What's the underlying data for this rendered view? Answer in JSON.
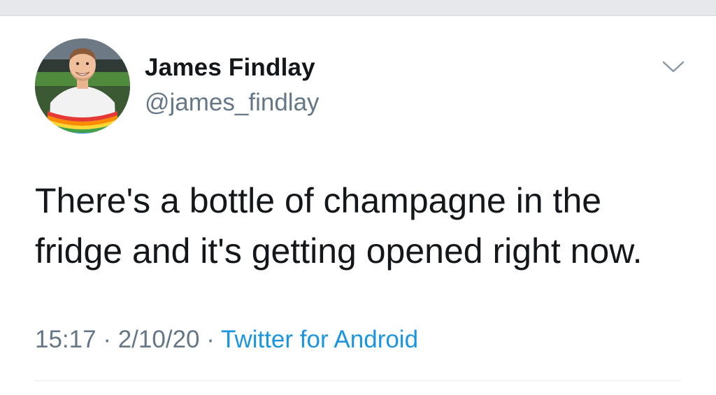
{
  "tweet": {
    "author": {
      "name": "James Findlay",
      "handle": "@james_findlay",
      "avatar_icon": "profile-photo-avatar"
    },
    "menu_icon": "chevron-down-icon",
    "text_lines": [
      "There's a bottle of champagne in the",
      "fridge and it's getting opened right now."
    ],
    "meta": {
      "time": "15:17",
      "separator": "·",
      "date": "2/10/20",
      "source": "Twitter for Android"
    }
  },
  "colors": {
    "text_primary": "#14171a",
    "text_secondary": "#657786",
    "link": "#1b95e0",
    "divider": "#e6ecf0"
  }
}
